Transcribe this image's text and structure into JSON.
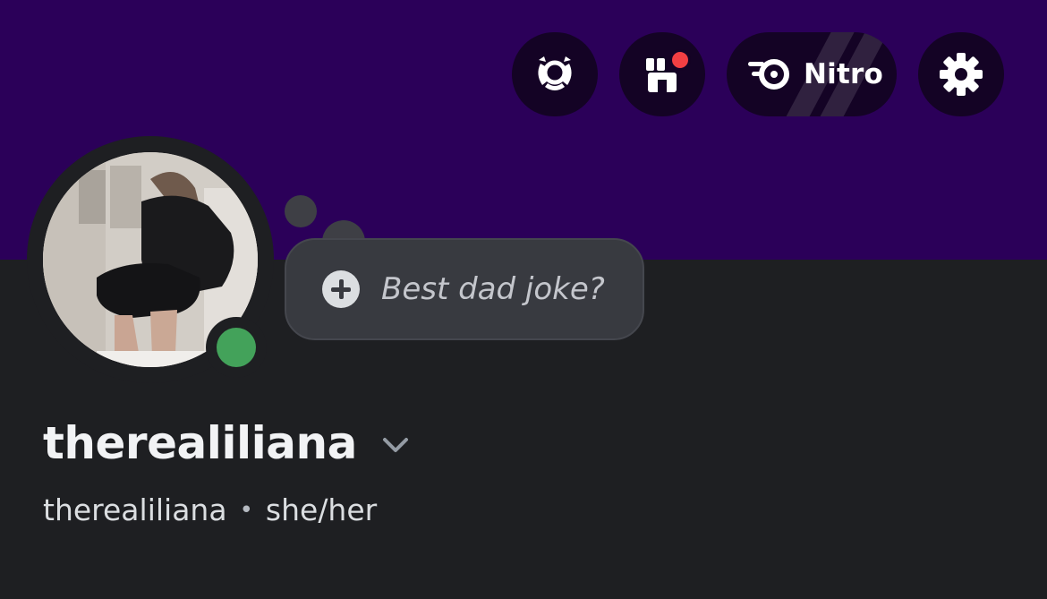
{
  "top_bar": {
    "nitro_label": "Nitro",
    "buttons": [
      {
        "name": "quests",
        "icon": "laurel-wreath-icon"
      },
      {
        "name": "shop",
        "icon": "shop-storefront-icon",
        "has_notification": true
      },
      {
        "name": "nitro",
        "icon": "nitro-icon"
      },
      {
        "name": "settings",
        "icon": "gear-icon"
      }
    ]
  },
  "profile": {
    "status": "online",
    "thought_bubble_placeholder": "Best dad joke?",
    "display_name": "therealiliana",
    "username": "therealiliana",
    "separator": "•",
    "pronouns": "she/her"
  },
  "colors": {
    "banner": "#2b0059",
    "background": "#1e1f22",
    "button_bg": "#140325",
    "online_status": "#43a25a",
    "notification_dot": "#f23f43",
    "bubble_bg": "#383a40"
  }
}
